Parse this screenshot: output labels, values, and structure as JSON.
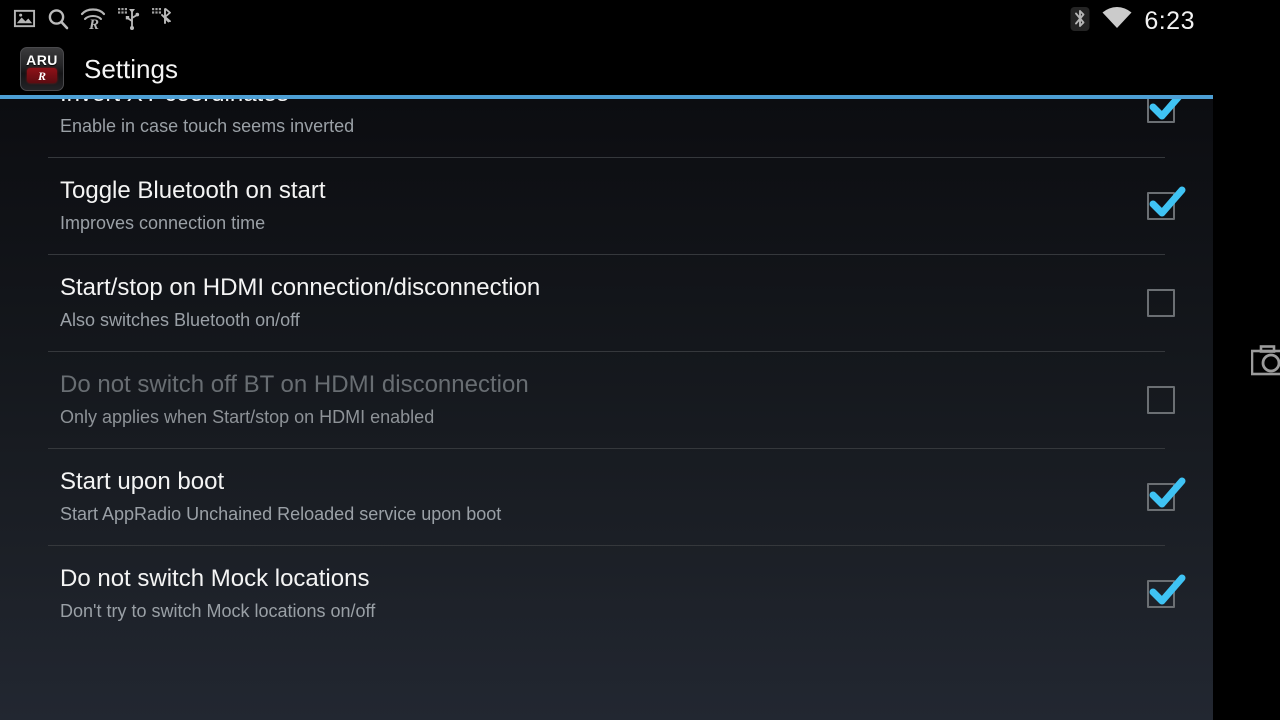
{
  "meta": {
    "accent_color": "#4d9fd4",
    "check_color": "#3fc3f4",
    "screen_bg_top": "#07070a",
    "screen_bg_bottom": "#222731"
  },
  "statusbar": {
    "left_icons": [
      {
        "name": "gallery-image-icon",
        "title": "Screenshot captured"
      },
      {
        "name": "search-icon",
        "title": "Search"
      },
      {
        "name": "appradio-r-icon",
        "title": "AppRadio Unchained"
      },
      {
        "name": "usb-debug-icon",
        "title": "USB connected"
      },
      {
        "name": "bluetooth-tether-icon",
        "title": "Bluetooth"
      }
    ],
    "right_icons": [
      {
        "name": "bluetooth-icon",
        "title": "Bluetooth on"
      },
      {
        "name": "wifi-icon",
        "title": "Wi-Fi connected"
      }
    ],
    "clock": "6:23"
  },
  "actionbar": {
    "app_icon": {
      "name": "app-icon-appradio-unchained",
      "top_text": "ARU",
      "badge_text": "R"
    },
    "title": "Settings"
  },
  "overlay": {
    "screenshot_icon_name": "camera-screenshot-icon"
  },
  "settings": {
    "rows": [
      {
        "key": "invert-xy-coordinates",
        "title": "Invert XY-coordinates",
        "subtitle": "Enable in case touch seems inverted",
        "checked": true,
        "enabled": true
      },
      {
        "key": "toggle-bluetooth-on-start",
        "title": "Toggle Bluetooth on start",
        "subtitle": "Improves connection time",
        "checked": true,
        "enabled": true
      },
      {
        "key": "start-stop-on-hdmi",
        "title": "Start/stop on HDMI connection/disconnection",
        "subtitle": "Also switches Bluetooth on/off",
        "checked": false,
        "enabled": true
      },
      {
        "key": "do-not-switch-off-bt-on-hdmi-disconnection",
        "title": "Do not switch off BT on HDMI disconnection",
        "subtitle": "Only applies when Start/stop on HDMI enabled",
        "checked": false,
        "enabled": false
      },
      {
        "key": "start-upon-boot",
        "title": "Start upon boot",
        "subtitle": "Start AppRadio Unchained Reloaded service upon boot",
        "checked": true,
        "enabled": true
      },
      {
        "key": "do-not-switch-mock-locations",
        "title": "Do not switch Mock locations",
        "subtitle": "Don't try to switch Mock locations on/off",
        "checked": true,
        "enabled": true
      }
    ]
  }
}
